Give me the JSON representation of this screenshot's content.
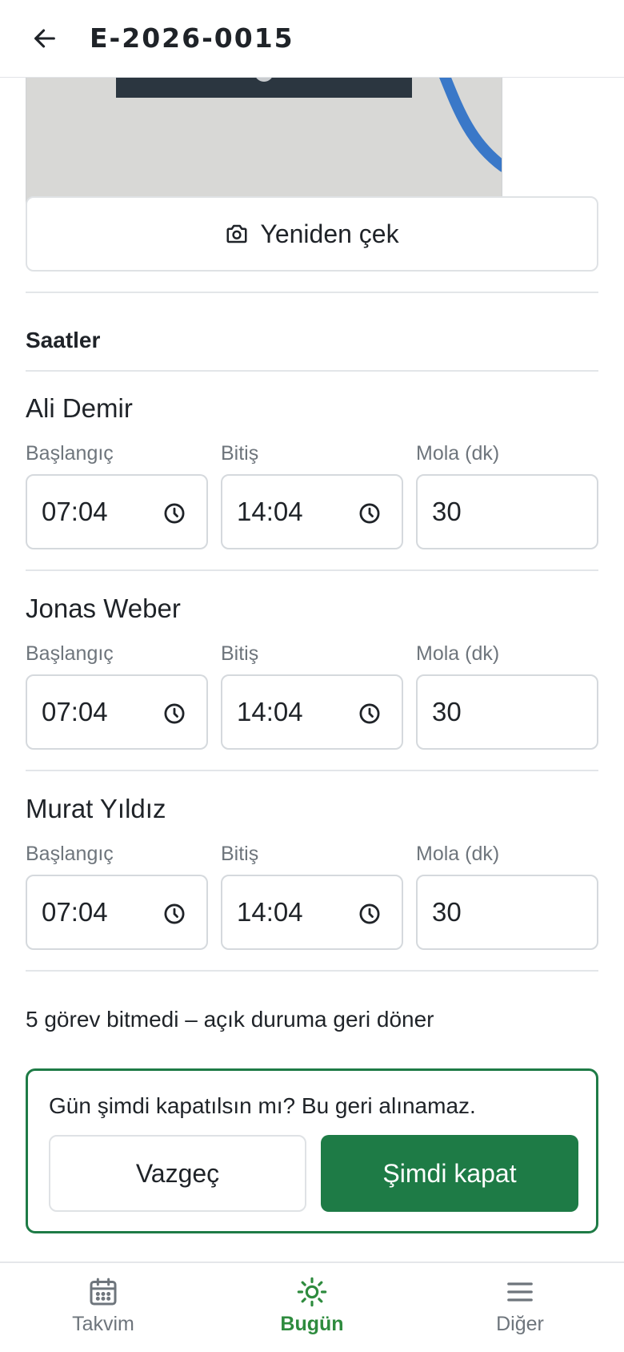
{
  "header": {
    "title": "E-2026-0015",
    "back_icon": "arrow-left-icon"
  },
  "photo": {
    "description_icon": "photo-preview"
  },
  "retake_button": {
    "label": "Yeniden çek",
    "icon": "camera-icon"
  },
  "hours": {
    "section_title": "Saatler",
    "labels": {
      "start": "Başlangıç",
      "end": "Bitiş",
      "break": "Mola (dk)"
    },
    "workers": [
      {
        "name": "Ali Demir",
        "start": "07:04",
        "end": "14:04",
        "break": "30"
      },
      {
        "name": "Jonas Weber",
        "start": "07:04",
        "end": "14:04",
        "break": "30"
      },
      {
        "name": "Murat Yıldız",
        "start": "07:04",
        "end": "14:04",
        "break": "30"
      }
    ]
  },
  "status_text": "5 görev bitmedi – açık duruma geri döner",
  "confirm": {
    "question": "Gün şimdi kapatılsın mı? Bu geri alınamaz.",
    "cancel_label": "Vazgeç",
    "confirm_label": "Şimdi kapat"
  },
  "nav": {
    "items": [
      {
        "label": "Takvim",
        "icon": "calendar-icon"
      },
      {
        "label": "Bugün",
        "icon": "sun-icon",
        "active": true
      },
      {
        "label": "Diğer",
        "icon": "menu-icon"
      }
    ]
  },
  "colors": {
    "accent": "#1e7b46",
    "nav_active": "#2e8b3e",
    "photo_bg": "#d8d8d6",
    "cable_blue": "#3a78c8"
  }
}
